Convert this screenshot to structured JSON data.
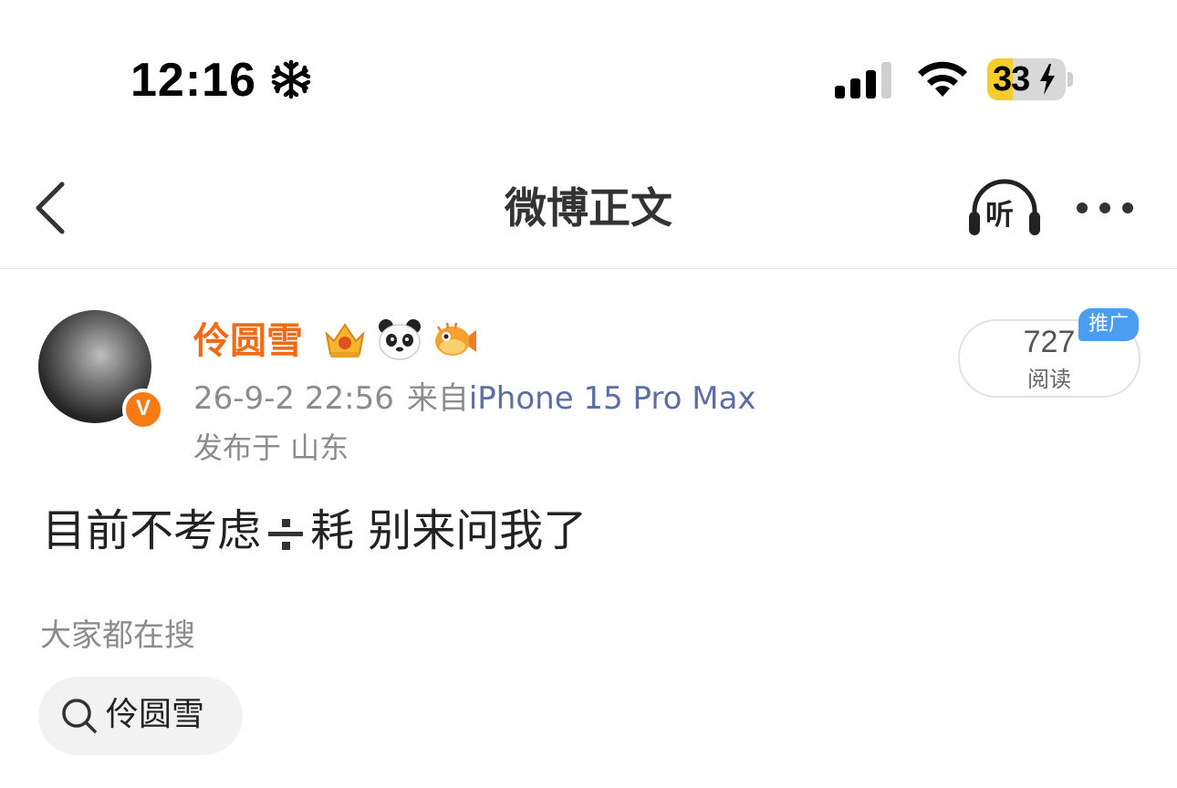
{
  "status_bar": {
    "time": "12:16",
    "battery_level": "33",
    "icons": [
      "snowflake-icon",
      "cellular-signal-icon",
      "wifi-icon",
      "battery-charging-icon"
    ]
  },
  "nav": {
    "title": "微博正文",
    "listen_label": "听",
    "icons": [
      "back-chevron-icon",
      "headphones-icon",
      "more-icon"
    ]
  },
  "post": {
    "username": "伶圆雪",
    "badges": [
      "crown-badge-icon",
      "panda-emoji-icon",
      "pufferfish-emoji-icon"
    ],
    "timestamp": "26-9-2 22:56",
    "from_label": "来自",
    "device": "iPhone 15 Pro Max",
    "location": "发布于 山东",
    "read_count": "727",
    "read_label": "阅读",
    "promo_label": "推广",
    "text_before": "目前不考虑",
    "text_after": "耗 别来问我了"
  },
  "search": {
    "heading": "大家都在搜",
    "chips": [
      {
        "label": "伶圆雪"
      }
    ]
  },
  "colors": {
    "username": "#f26b14",
    "device_link": "#5b6fa6",
    "verified_badge": "#f77b14",
    "promo": "#4a9df0",
    "battery_fill": "#f6cd2a"
  }
}
